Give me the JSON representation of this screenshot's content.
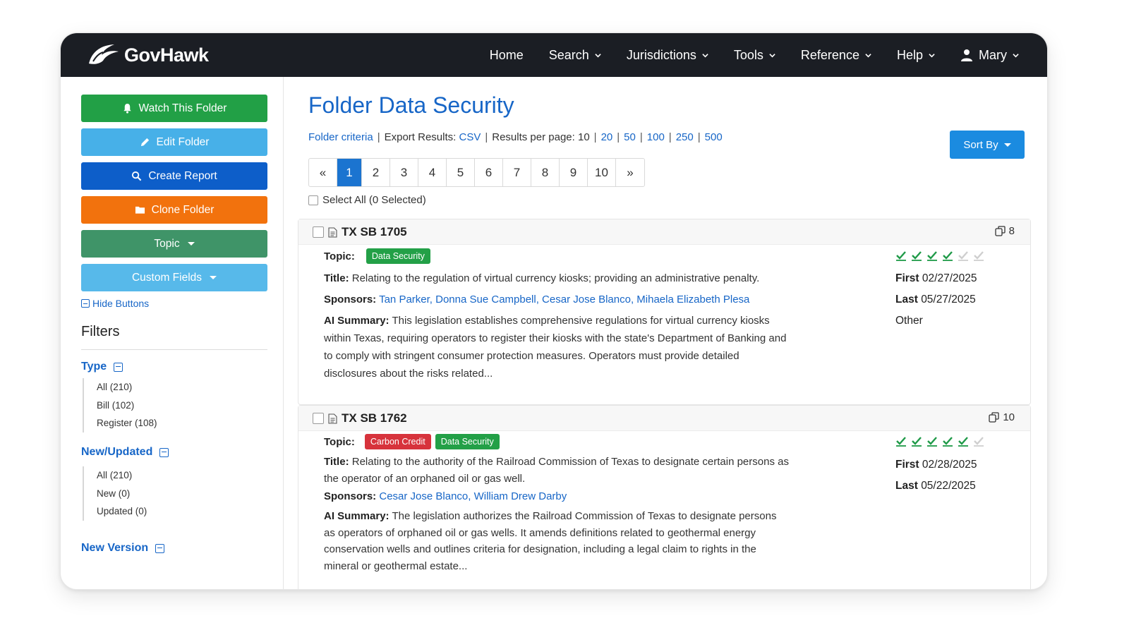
{
  "brand": {
    "name": "GovHawk"
  },
  "nav": {
    "items": [
      {
        "label": "Home",
        "dropdown": false
      },
      {
        "label": "Search",
        "dropdown": true
      },
      {
        "label": "Jurisdictions",
        "dropdown": true
      },
      {
        "label": "Tools",
        "dropdown": true
      },
      {
        "label": "Reference",
        "dropdown": true
      },
      {
        "label": "Help",
        "dropdown": true
      }
    ],
    "user": "Mary"
  },
  "sidebar": {
    "buttons": {
      "watch": "Watch This Folder",
      "edit": "Edit Folder",
      "report": "Create Report",
      "clone": "Clone Folder",
      "topic": "Topic",
      "custom": "Custom Fields"
    },
    "hide_buttons": "Hide Buttons",
    "filters_title": "Filters",
    "groups": {
      "type": {
        "title": "Type",
        "items": [
          "All (210)",
          "Bill (102)",
          "Register (108)"
        ]
      },
      "new_updated": {
        "title": "New/Updated",
        "items": [
          "All (210)",
          "New (0)",
          "Updated (0)"
        ]
      },
      "new_version": {
        "title": "New Version"
      }
    }
  },
  "main": {
    "title": "Folder Data Security",
    "criteria_link": "Folder criteria",
    "export_label": "Export Results:",
    "export_csv": "CSV",
    "per_page_label": "Results per page: 10",
    "per_page_options": [
      "20",
      "50",
      "100",
      "250",
      "500"
    ],
    "sort_by": "Sort By",
    "pager": {
      "prev": "«",
      "pages": [
        "1",
        "2",
        "3",
        "4",
        "5",
        "6",
        "7",
        "8",
        "9",
        "10"
      ],
      "next": "»",
      "active": "1"
    },
    "select_all": "Select All (0 Selected)"
  },
  "labels": {
    "topic": "Topic:",
    "title": "Title:",
    "sponsors": "Sponsors:",
    "ai_summary": "AI Summary:",
    "first": "First",
    "last": "Last"
  },
  "bills": [
    {
      "id": "TX SB 1705",
      "versions": "8",
      "topics": [
        {
          "label": "Data Security",
          "color": "#23a047"
        }
      ],
      "title": "Relating to the regulation of virtual currency kiosks; providing an administrative penalty.",
      "sponsors": "Tan Parker, Donna Sue Campbell, Cesar Jose Blanco, Mihaela Elizabeth Plesa",
      "summary": "This legislation establishes comprehensive regulations for virtual currency kiosks within Texas, requiring operators to register their kiosks with the state's Department of Banking and to comply with stringent consumer protection measures. Operators must provide detailed disclosures about the risks related...",
      "progress_done": 4,
      "progress_total": 6,
      "first": "02/27/2025",
      "last": "05/27/2025",
      "status": "Other"
    },
    {
      "id": "TX SB 1762",
      "versions": "10",
      "topics": [
        {
          "label": "Carbon Credit",
          "color": "#d7333c"
        },
        {
          "label": "Data Security",
          "color": "#23a047"
        }
      ],
      "title": "Relating to the authority of the Railroad Commission of Texas to designate certain persons as the operator of an orphaned oil or gas well.",
      "sponsors": "Cesar Jose Blanco, William Drew Darby",
      "summary": "The legislation authorizes the Railroad Commission of Texas to designate persons as operators of orphaned oil or gas wells. It amends definitions related to geothermal energy conservation wells and outlines criteria for designation, including a legal claim to rights in the mineral or geothermal estate...",
      "progress_done": 5,
      "progress_total": 6,
      "first": "02/28/2025",
      "last": "05/22/2025"
    }
  ],
  "colors": {
    "navbar": "#1b1e24",
    "link": "#1766c7",
    "check_done": "#1f9a48",
    "check_pending": "#cfcfcf"
  }
}
